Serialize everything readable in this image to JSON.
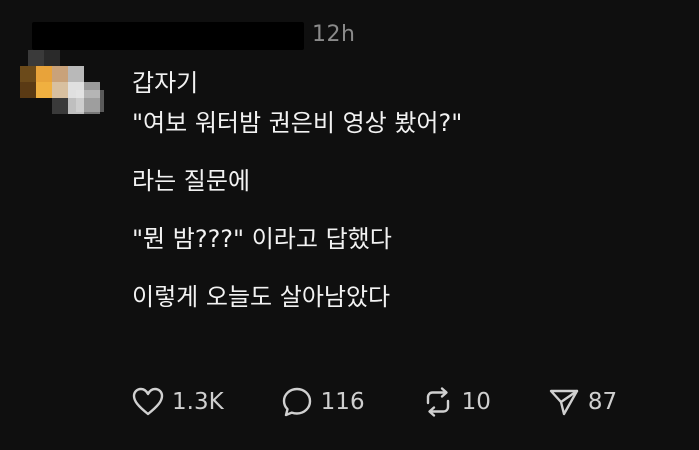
{
  "post": {
    "timestamp": "12h",
    "body_lines": [
      "갑자기",
      "\"여보 워터밤 권은비 영상 봤어?\"",
      "라는 질문에",
      "\"뭔 밤???\" 이라고 답했다",
      "이렇게 오늘도 살아남았다"
    ]
  },
  "actions": {
    "like": {
      "icon": "heart-icon",
      "count": "1.3K"
    },
    "reply": {
      "icon": "speech-bubble-icon",
      "count": "116"
    },
    "repost": {
      "icon": "repost-arrows-icon",
      "count": "10"
    },
    "share": {
      "icon": "send-icon",
      "count": "87"
    }
  },
  "colors": {
    "background": "#0f0f0f",
    "text": "#f2f2f2",
    "muted": "#8a8a8a",
    "icon": "#d0d0d0"
  }
}
